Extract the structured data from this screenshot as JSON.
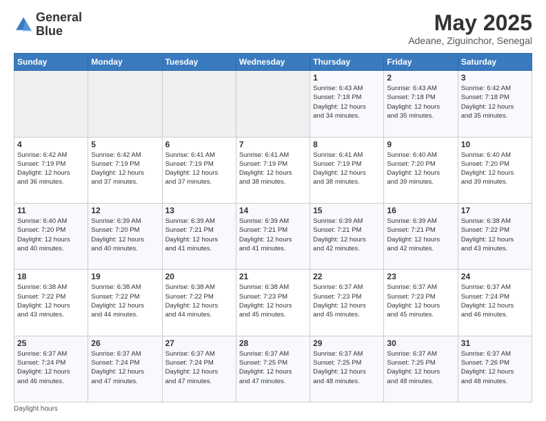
{
  "logo": {
    "line1": "General",
    "line2": "Blue"
  },
  "title": "May 2025",
  "subtitle": "Adeane, Ziguinchor, Senegal",
  "days_of_week": [
    "Sunday",
    "Monday",
    "Tuesday",
    "Wednesday",
    "Thursday",
    "Friday",
    "Saturday"
  ],
  "footer": "Daylight hours",
  "weeks": [
    [
      {
        "day": "",
        "info": ""
      },
      {
        "day": "",
        "info": ""
      },
      {
        "day": "",
        "info": ""
      },
      {
        "day": "",
        "info": ""
      },
      {
        "day": "1",
        "info": "Sunrise: 6:43 AM\nSunset: 7:18 PM\nDaylight: 12 hours\nand 34 minutes."
      },
      {
        "day": "2",
        "info": "Sunrise: 6:43 AM\nSunset: 7:18 PM\nDaylight: 12 hours\nand 35 minutes."
      },
      {
        "day": "3",
        "info": "Sunrise: 6:42 AM\nSunset: 7:18 PM\nDaylight: 12 hours\nand 35 minutes."
      }
    ],
    [
      {
        "day": "4",
        "info": "Sunrise: 6:42 AM\nSunset: 7:19 PM\nDaylight: 12 hours\nand 36 minutes."
      },
      {
        "day": "5",
        "info": "Sunrise: 6:42 AM\nSunset: 7:19 PM\nDaylight: 12 hours\nand 37 minutes."
      },
      {
        "day": "6",
        "info": "Sunrise: 6:41 AM\nSunset: 7:19 PM\nDaylight: 12 hours\nand 37 minutes."
      },
      {
        "day": "7",
        "info": "Sunrise: 6:41 AM\nSunset: 7:19 PM\nDaylight: 12 hours\nand 38 minutes."
      },
      {
        "day": "8",
        "info": "Sunrise: 6:41 AM\nSunset: 7:19 PM\nDaylight: 12 hours\nand 38 minutes."
      },
      {
        "day": "9",
        "info": "Sunrise: 6:40 AM\nSunset: 7:20 PM\nDaylight: 12 hours\nand 39 minutes."
      },
      {
        "day": "10",
        "info": "Sunrise: 6:40 AM\nSunset: 7:20 PM\nDaylight: 12 hours\nand 39 minutes."
      }
    ],
    [
      {
        "day": "11",
        "info": "Sunrise: 6:40 AM\nSunset: 7:20 PM\nDaylight: 12 hours\nand 40 minutes."
      },
      {
        "day": "12",
        "info": "Sunrise: 6:39 AM\nSunset: 7:20 PM\nDaylight: 12 hours\nand 40 minutes."
      },
      {
        "day": "13",
        "info": "Sunrise: 6:39 AM\nSunset: 7:21 PM\nDaylight: 12 hours\nand 41 minutes."
      },
      {
        "day": "14",
        "info": "Sunrise: 6:39 AM\nSunset: 7:21 PM\nDaylight: 12 hours\nand 41 minutes."
      },
      {
        "day": "15",
        "info": "Sunrise: 6:39 AM\nSunset: 7:21 PM\nDaylight: 12 hours\nand 42 minutes."
      },
      {
        "day": "16",
        "info": "Sunrise: 6:39 AM\nSunset: 7:21 PM\nDaylight: 12 hours\nand 42 minutes."
      },
      {
        "day": "17",
        "info": "Sunrise: 6:38 AM\nSunset: 7:22 PM\nDaylight: 12 hours\nand 43 minutes."
      }
    ],
    [
      {
        "day": "18",
        "info": "Sunrise: 6:38 AM\nSunset: 7:22 PM\nDaylight: 12 hours\nand 43 minutes."
      },
      {
        "day": "19",
        "info": "Sunrise: 6:38 AM\nSunset: 7:22 PM\nDaylight: 12 hours\nand 44 minutes."
      },
      {
        "day": "20",
        "info": "Sunrise: 6:38 AM\nSunset: 7:22 PM\nDaylight: 12 hours\nand 44 minutes."
      },
      {
        "day": "21",
        "info": "Sunrise: 6:38 AM\nSunset: 7:23 PM\nDaylight: 12 hours\nand 45 minutes."
      },
      {
        "day": "22",
        "info": "Sunrise: 6:37 AM\nSunset: 7:23 PM\nDaylight: 12 hours\nand 45 minutes."
      },
      {
        "day": "23",
        "info": "Sunrise: 6:37 AM\nSunset: 7:23 PM\nDaylight: 12 hours\nand 45 minutes."
      },
      {
        "day": "24",
        "info": "Sunrise: 6:37 AM\nSunset: 7:24 PM\nDaylight: 12 hours\nand 46 minutes."
      }
    ],
    [
      {
        "day": "25",
        "info": "Sunrise: 6:37 AM\nSunset: 7:24 PM\nDaylight: 12 hours\nand 46 minutes."
      },
      {
        "day": "26",
        "info": "Sunrise: 6:37 AM\nSunset: 7:24 PM\nDaylight: 12 hours\nand 47 minutes."
      },
      {
        "day": "27",
        "info": "Sunrise: 6:37 AM\nSunset: 7:24 PM\nDaylight: 12 hours\nand 47 minutes."
      },
      {
        "day": "28",
        "info": "Sunrise: 6:37 AM\nSunset: 7:25 PM\nDaylight: 12 hours\nand 47 minutes."
      },
      {
        "day": "29",
        "info": "Sunrise: 6:37 AM\nSunset: 7:25 PM\nDaylight: 12 hours\nand 48 minutes."
      },
      {
        "day": "30",
        "info": "Sunrise: 6:37 AM\nSunset: 7:25 PM\nDaylight: 12 hours\nand 48 minutes."
      },
      {
        "day": "31",
        "info": "Sunrise: 6:37 AM\nSunset: 7:26 PM\nDaylight: 12 hours\nand 48 minutes."
      }
    ]
  ]
}
